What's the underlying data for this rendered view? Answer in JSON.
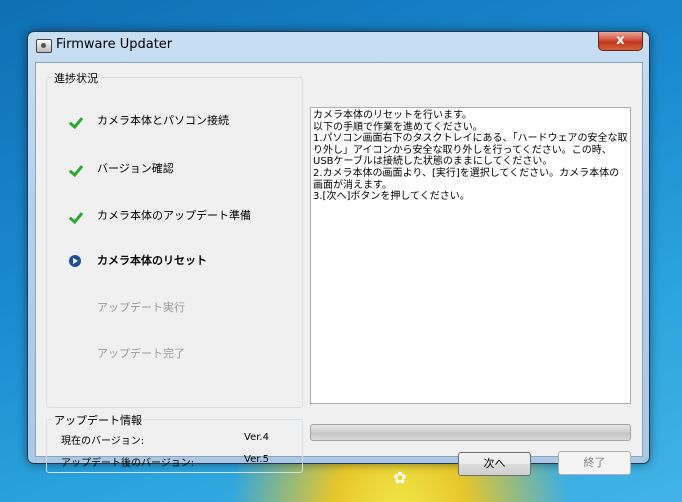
{
  "window": {
    "title": "Firmware Updater",
    "close_label": "x"
  },
  "progress_group": {
    "label": "進捗状況",
    "steps": [
      {
        "label": "カメラ本体とパソコン接続",
        "state": "done"
      },
      {
        "label": "バージョン確認",
        "state": "done"
      },
      {
        "label": "カメラ本体のアップデート準備",
        "state": "done"
      },
      {
        "label": "カメラ本体のリセット",
        "state": "current"
      },
      {
        "label": "アップデート実行",
        "state": "pending"
      },
      {
        "label": "アップデート完了",
        "state": "pending"
      }
    ]
  },
  "instructions": {
    "lines": [
      "カメラ本体のリセットを行います。",
      "以下の手順で作業を進めてください。",
      "",
      "1.パソコン画面右下のタスクトレイにある、「ハードウェアの安全な取り外し」アイコンから安全な取り外しを行ってください。この時、USBケーブルは接続した状態のままにしてください。",
      "2.カメラ本体の画面より、[実行]を選択してください。カメラ本体の画面が消えます。",
      "3.[次へ]ボタンを押してください。"
    ]
  },
  "update_info": {
    "label": "アップデート情報",
    "current_version_label": "現在のバージョン:",
    "current_version": "Ver.4",
    "new_version_label": "アップデート後のバージョン:",
    "new_version": "Ver.5"
  },
  "progress_bar": {
    "fraction": 0
  },
  "buttons": {
    "next_label": "次へ",
    "exit_label": "終了"
  },
  "colors": {
    "check": "#2fa733",
    "current_marker": "#1e4f9c",
    "pending_text": "#9a9a9a"
  }
}
